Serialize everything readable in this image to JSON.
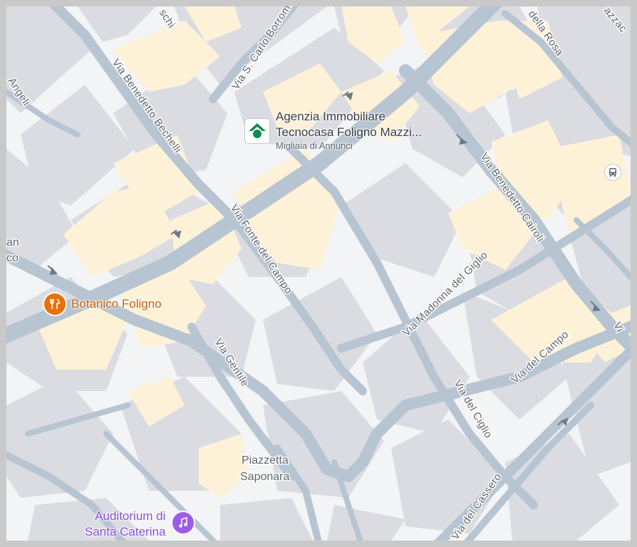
{
  "colors": {
    "background": "#f3f4f6",
    "block": "#dadce2",
    "building": "#fdf2d8",
    "road": "#b7c4d1",
    "road_arrow": "#6b7b8c",
    "restaurant": "#e8710a",
    "music": "#9c5ce8",
    "agency": "#0b8f4d",
    "transit": "#5f6368"
  },
  "streets": [
    {
      "name": "Via S. Carlo Borromeo"
    },
    {
      "name": "Via Benedetto Bechelli"
    },
    {
      "name": "Via Benedetto Cairoli"
    },
    {
      "name": "Via Fonte del Campo"
    },
    {
      "name": "Via Madonna del Giglio"
    },
    {
      "name": "Via del Campo"
    },
    {
      "name": "Via Gentile"
    },
    {
      "name": "Via del Ciglio"
    },
    {
      "name": "Via del Cassero"
    },
    {
      "name": "della Rosa"
    },
    {
      "name": "Angeli"
    },
    {
      "name": "Vi"
    },
    {
      "name": "schi"
    },
    {
      "name": "azzac"
    }
  ],
  "edge_labels": {
    "left_top": "an",
    "left_bottom": "co"
  },
  "places": [
    {
      "name_line1": "Piazzetta",
      "name_line2": "Saponara"
    }
  ],
  "pois": {
    "agency": {
      "title_line1": "Agenzia Immobiliare",
      "title_line2": "Tecnocasa Foligno Mazzi...",
      "subtitle": "Migliaia di Annunci",
      "icon": "house-icon"
    },
    "restaurant": {
      "name": "Botanico Foligno",
      "icon": "fork-knife-icon"
    },
    "auditorium": {
      "name_line1": "Auditorium di",
      "name_line2": "Santa Caterina",
      "icon": "music-note-icon"
    },
    "transit": {
      "icon": "bus-icon"
    }
  }
}
